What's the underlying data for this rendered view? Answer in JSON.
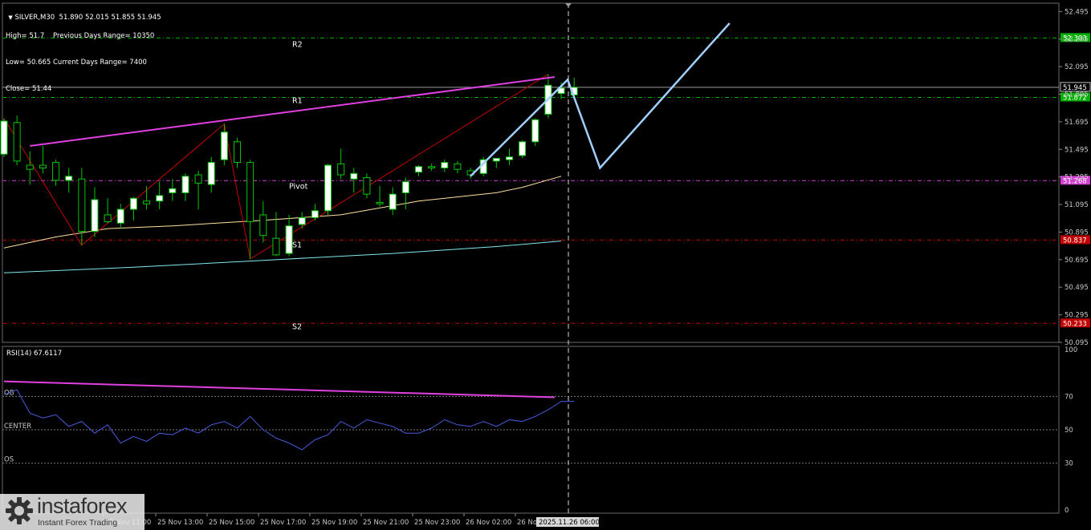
{
  "header": {
    "symbol_line": "SILVER,M30  51.890 52.015 51.855 51.945",
    "stats": [
      {
        "left": "High= 51.7",
        "right": "Previous Days Range= 10350"
      },
      {
        "left": "Low= 50.665",
        "right": "Current Days Range= 7400"
      },
      {
        "left": "Close= 51.44",
        "right": ""
      }
    ]
  },
  "logo": {
    "name": "instaforex",
    "tagline": "Instant Forex Trading"
  },
  "colors": {
    "background": "#000000",
    "grid": "#4a4a4a",
    "bull_candle": "#ffffff",
    "bear_candle": "#000000",
    "candle_wick": "#00c800",
    "zigzag": "#c80000",
    "resistance_line": "#e040e0",
    "forecast": "#a0d0ff",
    "ma_fast": "#ffe0a0",
    "ma_slow": "#80e8f0",
    "rsi_line": "#4a5adc",
    "level_green": "#00b000",
    "level_pink": "#d040d0",
    "level_red": "#c00000"
  },
  "chart_data": {
    "type": "candlestick",
    "symbol": "SILVER",
    "timeframe": "M30",
    "ylim": [
      50.095,
      52.555
    ],
    "y_ticks": [
      52.495,
      52.295,
      52.095,
      51.895,
      51.695,
      51.495,
      51.295,
      51.095,
      50.895,
      50.695,
      50.495,
      50.295,
      50.095
    ],
    "x_tick_labels": [
      "25 Nov 11:00",
      "25 Nov 13:00",
      "25 Nov 15:00",
      "25 Nov 17:00",
      "25 Nov 19:00",
      "25 Nov 21:00",
      "25 Nov 23:00",
      "26 Nov 02:00",
      "26 No"
    ],
    "crosshair_time": "2025.11.26 06:00",
    "current_price": {
      "value": 51.945,
      "label": "51.945"
    },
    "candles": [
      {
        "o": 51.46,
        "h": 51.72,
        "l": 51.44,
        "c": 51.7
      },
      {
        "o": 51.69,
        "h": 51.74,
        "l": 51.38,
        "c": 51.41
      },
      {
        "o": 51.38,
        "h": 51.48,
        "l": 51.24,
        "c": 51.35
      },
      {
        "o": 51.38,
        "h": 51.52,
        "l": 51.32,
        "c": 51.36
      },
      {
        "o": 51.4,
        "h": 51.42,
        "l": 51.23,
        "c": 51.27
      },
      {
        "o": 51.27,
        "h": 51.36,
        "l": 51.18,
        "c": 51.3
      },
      {
        "o": 51.28,
        "h": 51.36,
        "l": 50.8,
        "c": 50.9
      },
      {
        "o": 50.9,
        "h": 51.22,
        "l": 50.86,
        "c": 51.13
      },
      {
        "o": 51.02,
        "h": 51.14,
        "l": 50.96,
        "c": 50.97
      },
      {
        "o": 50.96,
        "h": 51.1,
        "l": 50.92,
        "c": 51.06
      },
      {
        "o": 51.06,
        "h": 51.15,
        "l": 50.98,
        "c": 51.14
      },
      {
        "o": 51.12,
        "h": 51.23,
        "l": 51.06,
        "c": 51.1
      },
      {
        "o": 51.12,
        "h": 51.26,
        "l": 51.06,
        "c": 51.16
      },
      {
        "o": 51.18,
        "h": 51.28,
        "l": 51.12,
        "c": 51.21
      },
      {
        "o": 51.18,
        "h": 51.32,
        "l": 51.12,
        "c": 51.3
      },
      {
        "o": 51.31,
        "h": 51.34,
        "l": 51.06,
        "c": 51.25
      },
      {
        "o": 51.24,
        "h": 51.44,
        "l": 51.18,
        "c": 51.4
      },
      {
        "o": 51.42,
        "h": 51.68,
        "l": 51.38,
        "c": 51.62
      },
      {
        "o": 51.55,
        "h": 51.58,
        "l": 51.36,
        "c": 51.4
      },
      {
        "o": 51.4,
        "h": 51.42,
        "l": 50.7,
        "c": 50.97
      },
      {
        "o": 51.02,
        "h": 51.12,
        "l": 50.82,
        "c": 50.87
      },
      {
        "o": 50.85,
        "h": 51.04,
        "l": 50.72,
        "c": 50.73
      },
      {
        "o": 50.74,
        "h": 51.02,
        "l": 50.72,
        "c": 50.94
      },
      {
        "o": 50.95,
        "h": 51.04,
        "l": 50.92,
        "c": 51.0
      },
      {
        "o": 51.0,
        "h": 51.1,
        "l": 50.98,
        "c": 51.05
      },
      {
        "o": 51.05,
        "h": 51.39,
        "l": 51.02,
        "c": 51.38
      },
      {
        "o": 51.39,
        "h": 51.5,
        "l": 51.28,
        "c": 51.31
      },
      {
        "o": 51.28,
        "h": 51.36,
        "l": 51.18,
        "c": 51.32
      },
      {
        "o": 51.29,
        "h": 51.32,
        "l": 51.14,
        "c": 51.17
      },
      {
        "o": 51.11,
        "h": 51.23,
        "l": 51.08,
        "c": 51.1
      },
      {
        "o": 51.06,
        "h": 51.22,
        "l": 51.02,
        "c": 51.17
      },
      {
        "o": 51.18,
        "h": 51.29,
        "l": 51.06,
        "c": 51.26
      },
      {
        "o": 51.33,
        "h": 51.38,
        "l": 51.3,
        "c": 51.37
      },
      {
        "o": 51.37,
        "h": 51.39,
        "l": 51.34,
        "c": 51.36
      },
      {
        "o": 51.36,
        "h": 51.42,
        "l": 51.33,
        "c": 51.4
      },
      {
        "o": 51.39,
        "h": 51.41,
        "l": 51.32,
        "c": 51.35
      },
      {
        "o": 51.34,
        "h": 51.36,
        "l": 51.28,
        "c": 51.31
      },
      {
        "o": 51.32,
        "h": 51.44,
        "l": 51.3,
        "c": 51.42
      },
      {
        "o": 51.41,
        "h": 51.43,
        "l": 51.36,
        "c": 51.43
      },
      {
        "o": 51.42,
        "h": 51.5,
        "l": 51.38,
        "c": 51.44
      },
      {
        "o": 51.45,
        "h": 51.56,
        "l": 51.43,
        "c": 51.55
      },
      {
        "o": 51.55,
        "h": 51.72,
        "l": 51.52,
        "c": 51.71
      },
      {
        "o": 51.75,
        "h": 52.04,
        "l": 51.72,
        "c": 51.96
      },
      {
        "o": 51.9,
        "h": 51.98,
        "l": 51.86,
        "c": 51.94
      },
      {
        "o": 51.89,
        "h": 52.015,
        "l": 51.855,
        "c": 51.945
      }
    ],
    "levels": [
      {
        "name": "R2",
        "value": 52.303,
        "label": "52.303",
        "color": "green"
      },
      {
        "name": "R1",
        "value": 51.872,
        "label": "51.872",
        "color": "green"
      },
      {
        "name": "Pivot",
        "value": 51.268,
        "label": "51.268",
        "color": "pink"
      },
      {
        "name": "S1",
        "value": 50.837,
        "label": "50.837",
        "color": "red"
      },
      {
        "name": "S2",
        "value": 50.233,
        "label": "50.233",
        "color": "red"
      }
    ],
    "zigzag": [
      {
        "i": 0,
        "y": 51.72
      },
      {
        "i": 6,
        "y": 50.8
      },
      {
        "i": 17,
        "y": 51.68
      },
      {
        "i": 19,
        "y": 50.7
      },
      {
        "i": 42,
        "y": 52.04
      }
    ],
    "resistance_trendline": [
      {
        "i": 2,
        "y": 51.52
      },
      {
        "i": 42.5,
        "y": 52.02
      }
    ],
    "ma_fast": [
      {
        "i": 0,
        "y": 50.78
      },
      {
        "i": 4,
        "y": 50.86
      },
      {
        "i": 8,
        "y": 50.92
      },
      {
        "i": 13,
        "y": 50.94
      },
      {
        "i": 20,
        "y": 50.98
      },
      {
        "i": 26,
        "y": 51.02
      },
      {
        "i": 32,
        "y": 51.12
      },
      {
        "i": 38,
        "y": 51.18
      },
      {
        "i": 40,
        "y": 51.22
      },
      {
        "i": 43,
        "y": 51.3
      }
    ],
    "ma_slow": [
      {
        "i": 0,
        "y": 50.6
      },
      {
        "i": 10,
        "y": 50.64
      },
      {
        "i": 20,
        "y": 50.69
      },
      {
        "i": 30,
        "y": 50.74
      },
      {
        "i": 38,
        "y": 50.79
      },
      {
        "i": 43,
        "y": 50.83
      }
    ],
    "forecast_path": [
      {
        "i": 36,
        "y": 51.3
      },
      {
        "i": 43.5,
        "y": 52.0
      },
      {
        "i": 46,
        "y": 51.36
      },
      {
        "i": 56,
        "y": 52.41
      }
    ],
    "rsi": {
      "label": "RSI(14) 67.6117",
      "ylim": [
        0,
        100
      ],
      "y_ticks": [
        100,
        70,
        50,
        30,
        0
      ],
      "zone_labels": {
        "ob": "OB",
        "center": "CENTER",
        "os": "OS"
      },
      "zone_levels": {
        "ob": 70,
        "center": 50,
        "os": 30
      },
      "values": [
        71,
        74,
        60,
        57,
        59,
        52,
        55,
        48,
        53,
        42,
        46,
        43,
        48,
        47,
        51,
        48,
        53,
        55,
        51,
        58,
        50,
        45,
        42,
        38,
        44,
        47,
        55,
        51,
        56,
        54,
        52,
        48,
        48,
        51,
        56,
        53,
        52,
        55,
        52,
        56,
        55,
        58,
        62,
        67,
        67
      ],
      "trendline": [
        {
          "i": 0,
          "y": 79
        },
        {
          "i": 42.5,
          "y": 69.5
        }
      ]
    }
  }
}
